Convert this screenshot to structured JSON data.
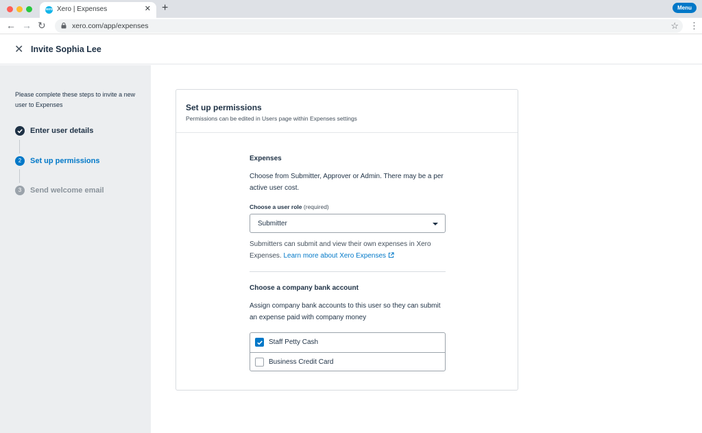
{
  "browser": {
    "tab_title": "Xero | Expenses",
    "favicon_text": "xero",
    "url": "xero.com/app/expenses",
    "menu_label": "Menu"
  },
  "header": {
    "title": "Invite Sophia Lee"
  },
  "sidebar": {
    "intro": "Please complete these steps to invite a new user to Expenses",
    "steps": [
      {
        "label": "Enter user details",
        "status": "done",
        "marker": ""
      },
      {
        "label": "Set up permissions",
        "status": "active",
        "marker": "2"
      },
      {
        "label": "Send welcome email",
        "status": "pending",
        "marker": "3"
      }
    ]
  },
  "card": {
    "title": "Set up permissions",
    "subtitle": "Permissions can be edited in Users page within Expenses settings",
    "expenses": {
      "title": "Expenses",
      "description": "Choose from Submitter, Approver or Admin. There may be a per active user cost.",
      "role_label": "Choose a user role",
      "role_required": "(required)",
      "role_value": "Submitter",
      "helper_text": "Submitters can submit and view their own expenses in Xero Expenses.",
      "learn_more": "Learn more about Xero Expenses"
    },
    "bank": {
      "title": "Choose a company bank account",
      "description": "Assign company bank accounts to this user so they can submit an expense paid with company money",
      "accounts": [
        {
          "label": "Staff Petty Cash",
          "checked": true
        },
        {
          "label": "Business Credit Card",
          "checked": false
        }
      ]
    }
  },
  "colors": {
    "accent": "#0078c8",
    "text": "#1e3145",
    "sidebar_bg": "#eceef0"
  }
}
